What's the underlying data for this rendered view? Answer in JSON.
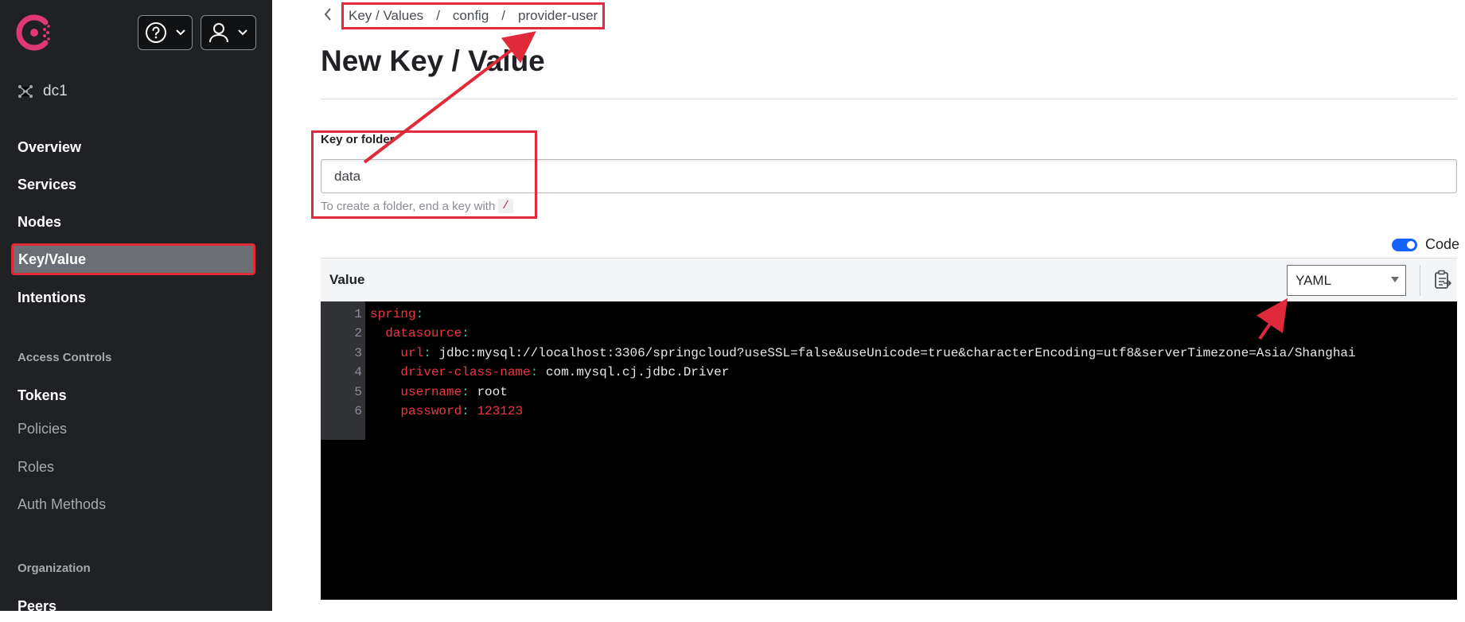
{
  "sidebar": {
    "datacenter": "dc1",
    "nav": [
      {
        "label": "Overview"
      },
      {
        "label": "Services"
      },
      {
        "label": "Nodes"
      },
      {
        "label": "Key/Value"
      },
      {
        "label": "Intentions"
      }
    ],
    "access_controls_heading": "Access Controls",
    "access_controls": [
      {
        "label": "Tokens"
      },
      {
        "label": "Policies"
      },
      {
        "label": "Roles"
      },
      {
        "label": "Auth Methods"
      }
    ],
    "organization_heading": "Organization",
    "organization": [
      {
        "label": "Peers"
      }
    ]
  },
  "breadcrumb": {
    "items": [
      "Key / Values",
      "config",
      "provider-user"
    ],
    "separator": "/"
  },
  "page": {
    "title": "New Key / Value"
  },
  "form": {
    "key_label": "Key or folder",
    "key_value": "data",
    "help_text": "To create a folder, end a key with",
    "help_code": "/",
    "code_toggle_label": "Code",
    "value_label": "Value",
    "mode": "YAML"
  },
  "editor": {
    "lines": [
      {
        "num": "1",
        "indent": "",
        "key": "spring",
        "value": ""
      },
      {
        "num": "2",
        "indent": "  ",
        "key": "datasource",
        "value": ""
      },
      {
        "num": "3",
        "indent": "    ",
        "key": "url",
        "value": "jdbc:mysql://localhost:3306/springcloud?useSSL=false&useUnicode=true&characterEncoding=utf8&serverTimezone=Asia/Shanghai"
      },
      {
        "num": "4",
        "indent": "    ",
        "key": "driver-class-name",
        "value": "com.mysql.cj.jdbc.Driver"
      },
      {
        "num": "5",
        "indent": "    ",
        "key": "username",
        "value": "root"
      },
      {
        "num": "6",
        "indent": "    ",
        "key": "password",
        "value": "123123"
      }
    ]
  },
  "colors": {
    "sidebar_bg": "#1f2124",
    "annotation_red": "#e02a3a",
    "toggle_blue": "#1563ff",
    "editor_bg": "#000000",
    "yaml_key": "#f0353f"
  }
}
